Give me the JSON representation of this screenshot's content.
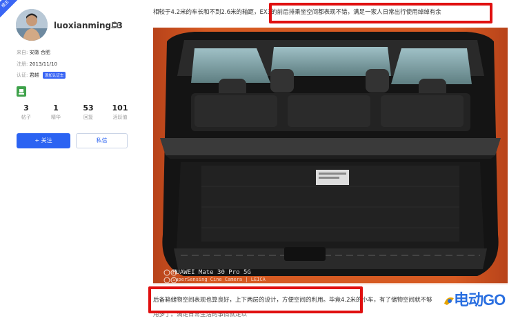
{
  "profile": {
    "badge": "楼主",
    "username": "luoxianming33",
    "from_label": "来自:",
    "from_value": "安徽 合肥",
    "reg_label": "注册:",
    "reg_value": "2013/11/10",
    "cert_label": "认证:",
    "cert_value": "君越",
    "cert_tag": "添加认证车"
  },
  "stats": [
    {
      "num": "3",
      "label": "帖子"
    },
    {
      "num": "1",
      "label": "精华"
    },
    {
      "num": "53",
      "label": "回复"
    },
    {
      "num": "101",
      "label": "活跃值"
    }
  ],
  "buttons": {
    "follow": "+ 关注",
    "message": "私信"
  },
  "post": {
    "line1_prefix": "相较于4.2米的车长和不到2.6米的轴距，",
    "line1_highlight": "EX3的前后排乘坐空间都表现不错，满足一家人日常出行使用绰绰有余",
    "line2": "后备箱储物空间表现也算良好，上下两层的设计，方便空间的利用。毕竟4.2米的小车，有了储物空间就不够",
    "line3": "用多了。满足日常生活的事情就足以"
  },
  "photo": {
    "watermark_model": "HUAWEI Mate 30 Pro 5G",
    "watermark_camera": "SuperSensing Cine Camera | LEICA",
    "body_color": "#c8501e",
    "interior_color": "#1b1b1b"
  },
  "logo": {
    "text": "电动GO"
  },
  "colors": {
    "accent": "#2b63f2",
    "highlight": "#e01010"
  }
}
